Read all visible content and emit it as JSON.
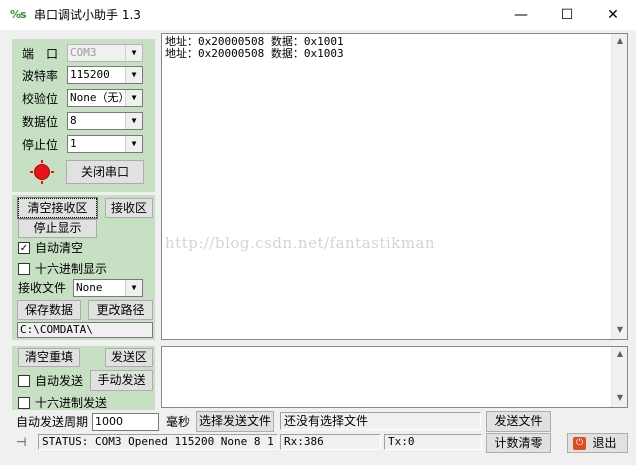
{
  "window": {
    "title": "串口调试小助手 1.3",
    "minimize": "—",
    "maximize": "☐",
    "close": "✕"
  },
  "serial": {
    "port_label": "端　口",
    "port_value": "COM3",
    "baud_label": "波特率",
    "baud_value": "115200",
    "parity_label": "校验位",
    "parity_value": "None（无）",
    "databits_label": "数据位",
    "databits_value": "8",
    "stopbits_label": "停止位",
    "stopbits_value": "1",
    "toggle_button": "关闭串口"
  },
  "receive": {
    "clear_button": "清空接收区",
    "area_label": "接收区",
    "stop_button": "停止显示",
    "auto_clear_label": "自动清空",
    "auto_clear_checked": "✓",
    "hex_label": "十六进制显示",
    "hex_checked": "",
    "file_label": "接收文件",
    "file_value": "None",
    "save_button": "保存数据",
    "change_path_button": "更改路径",
    "path": "C:\\COMDATA\\",
    "lines": [
      "地址：0x20000508 数据：0x1001",
      "地址：0x20000508 数据：0x1003"
    ],
    "watermark": "http://blog.csdn.net/fantastikman"
  },
  "send": {
    "reset_button": "清空重填",
    "area_label": "发送区",
    "auto_send_label": "自动发送",
    "auto_send_checked": "",
    "manual_button": "手动发送",
    "hex_label": "十六进制发送",
    "hex_checked": "",
    "period_label": "自动发送周期",
    "period_value": "1000",
    "ms_label": "毫秒",
    "choose_file_button": "选择发送文件",
    "file_status": "还没有选择文件",
    "send_file_button": "发送文件",
    "counter_clear_button": "计数清零",
    "exit_button": "退出"
  },
  "status": {
    "text": "STATUS: COM3 Opened 115200 None  8 1",
    "rx": "Rx:386",
    "tx": "Tx:0"
  },
  "colors": {
    "panel_green": "#c7e0c4",
    "led_red": "#e8141c"
  }
}
